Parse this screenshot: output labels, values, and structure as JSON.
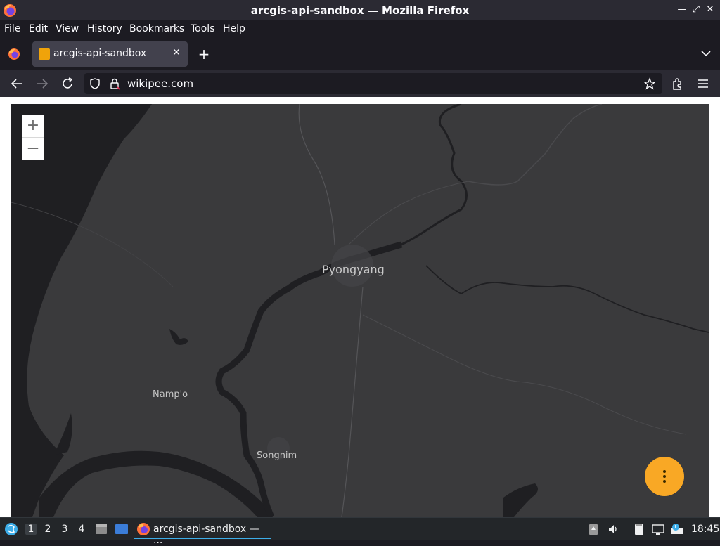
{
  "window": {
    "title": "arcgis-api-sandbox — Mozilla Firefox"
  },
  "menu": {
    "items": [
      "File",
      "Edit",
      "View",
      "History",
      "Bookmarks",
      "Tools",
      "Help"
    ]
  },
  "tabs": [
    {
      "title": "arcgis-api-sandbox",
      "favicon": "sandbox-favicon-icon",
      "favicon_color": "#f0a30a"
    }
  ],
  "navbar": {
    "url": "wikipee.com"
  },
  "map": {
    "background_color": "#3a3a3c",
    "water_color": "#1f1f22",
    "zoom_in_label": "+",
    "zoom_out_label": "—",
    "labels": {
      "pyongyang": "Pyongyang",
      "nampo": "Namp'o",
      "songnim": "Songnim"
    },
    "fab_color": "#f9a825",
    "fab_icon": "more-vertical-icon"
  },
  "taskbar": {
    "workspaces": [
      "1",
      "2",
      "3",
      "4"
    ],
    "active_workspace": "1",
    "task_title": "arcgis-api-sandbox — ...",
    "clock": "18:45"
  }
}
